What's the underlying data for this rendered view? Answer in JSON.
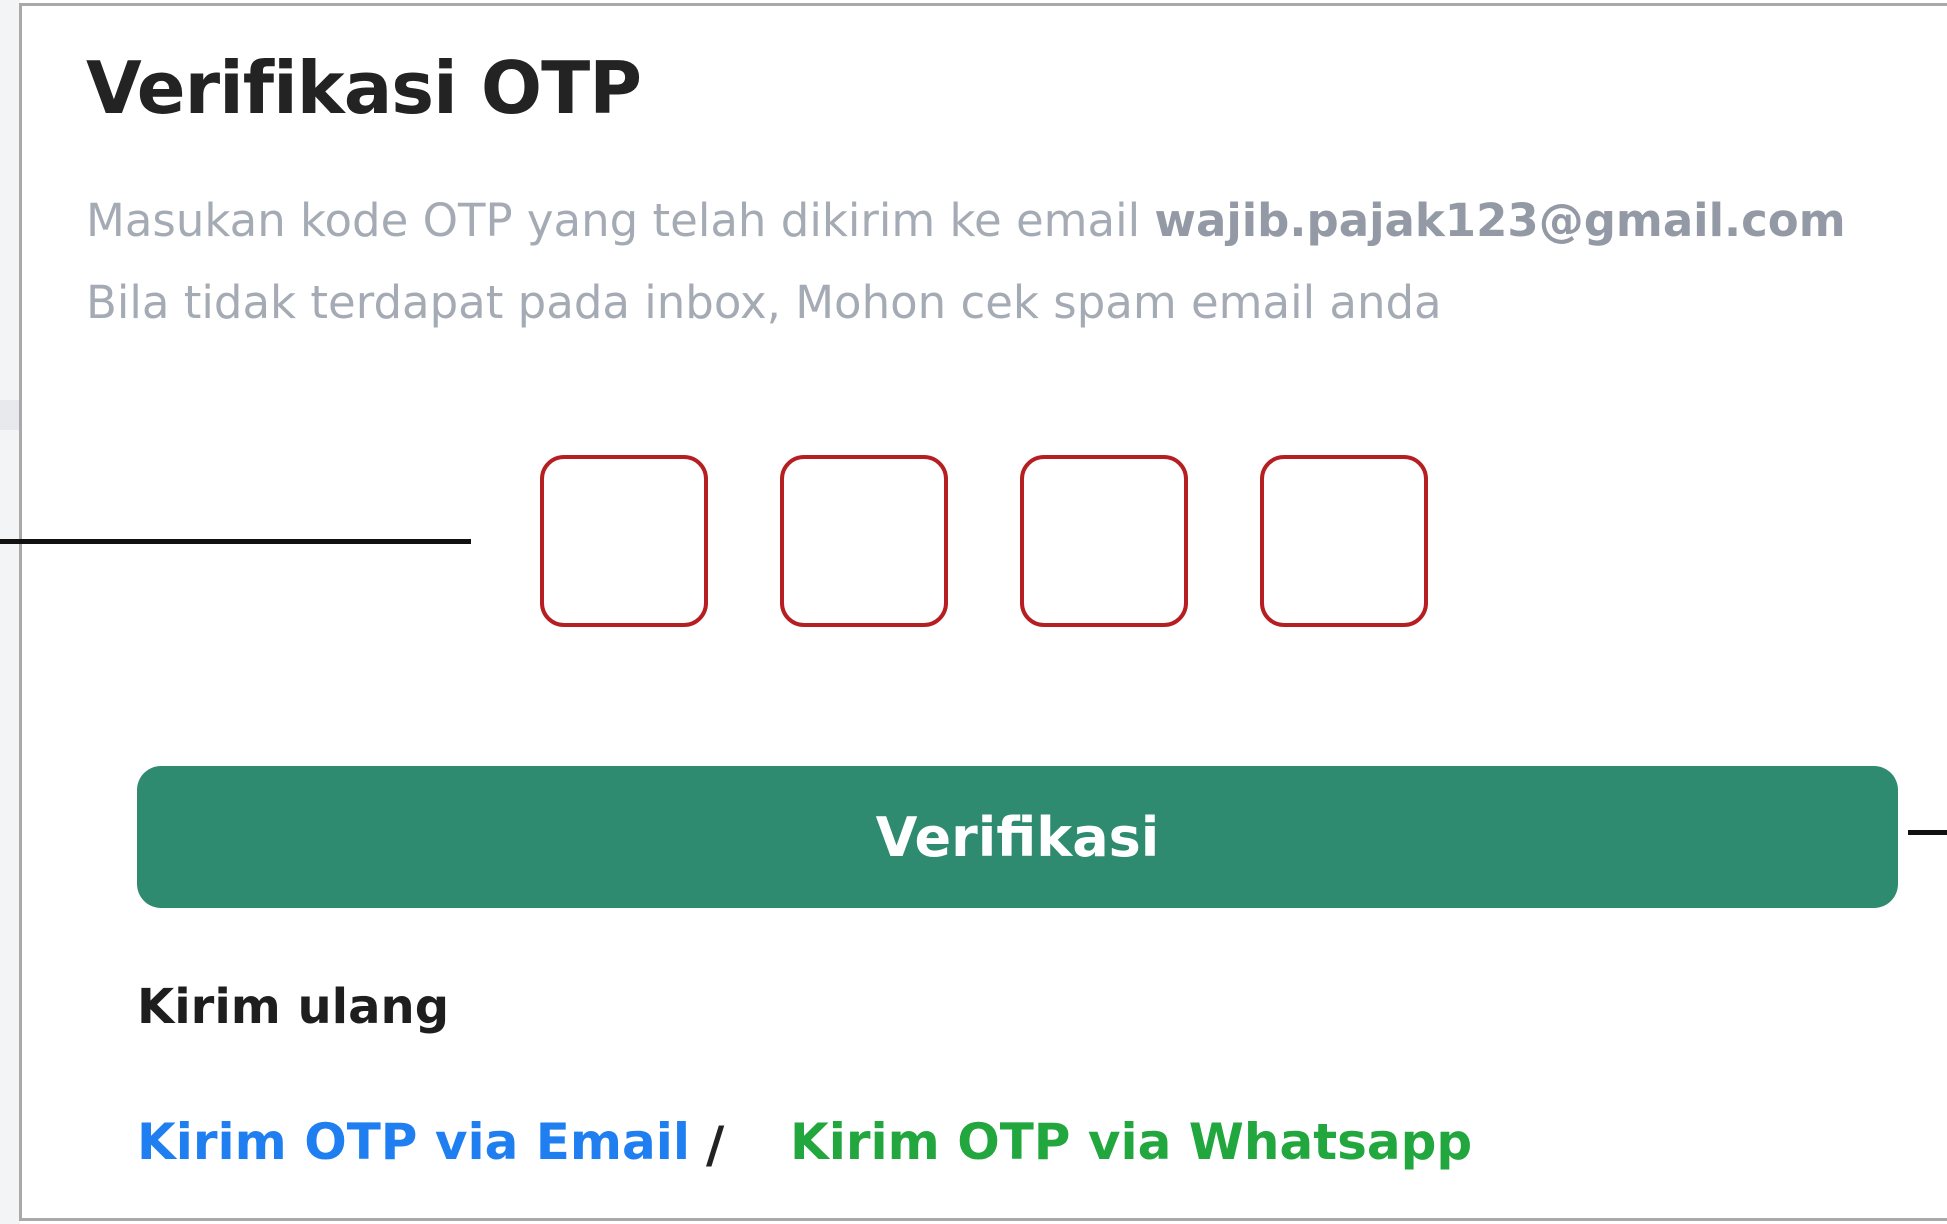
{
  "otp_card": {
    "title": "Verifikasi OTP",
    "instruction_prefix": "Masukan kode OTP yang telah dikirim ke email ",
    "email": "wajib.pajak123@gmail.com",
    "instruction_line2": "Bila tidak terdapat pada inbox, Mohon cek spam email anda",
    "otp_digits": [
      "",
      "",
      "",
      ""
    ],
    "verify_label": "Verifikasi",
    "resend_label": "Kirim ulang",
    "resend_email_label": "Kirim OTP via Email",
    "separator": "/",
    "resend_whatsapp_label": "Kirim OTP via Whatsapp"
  },
  "colors": {
    "otp_box_border": "#b51f22",
    "verify_button": "#2e8b6f",
    "email_link": "#1f7ff0",
    "whatsapp_link": "#22a63e",
    "muted_text": "#a5abb5"
  }
}
